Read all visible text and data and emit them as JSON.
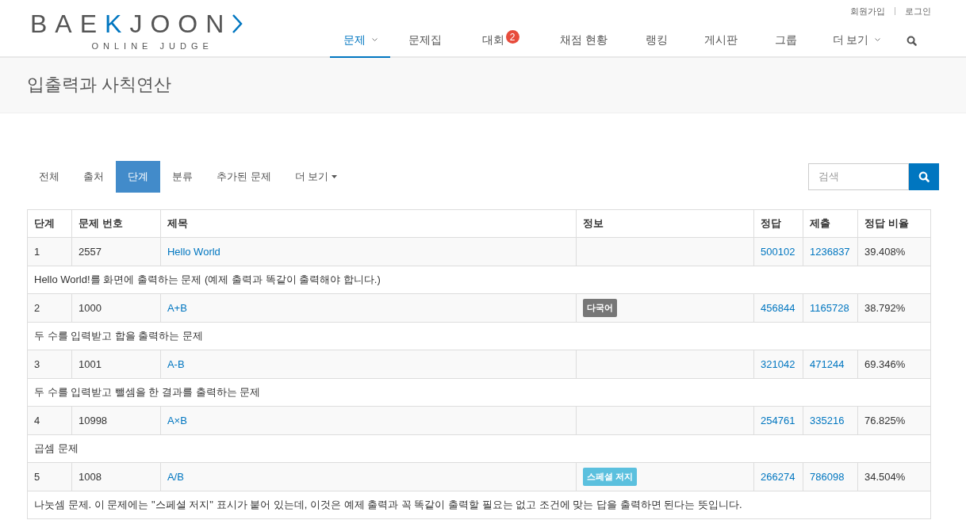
{
  "logo": {
    "parts": [
      {
        "text": "BAE",
        "accent": false
      },
      {
        "text": "K",
        "accent": true
      },
      {
        "text": "JOON",
        "accent": false
      }
    ],
    "subtitle": "ONLINE JUDGE"
  },
  "top_links": [
    "회원가입",
    "로그인"
  ],
  "nav": [
    {
      "label": "문제",
      "selected": true,
      "dropdown": true
    },
    {
      "label": "문제집",
      "selected": false,
      "dropdown": false
    },
    {
      "label": "대회",
      "selected": false,
      "dropdown": false,
      "badge": "2"
    },
    {
      "label": "채점 현황",
      "selected": false,
      "dropdown": false
    },
    {
      "label": "랭킹",
      "selected": false,
      "dropdown": false
    },
    {
      "label": "게시판",
      "selected": false,
      "dropdown": false
    },
    {
      "label": "그룹",
      "selected": false,
      "dropdown": false
    },
    {
      "label": "더 보기",
      "selected": false,
      "dropdown": true
    }
  ],
  "page_title": "입출력과 사칙연산",
  "tabs": [
    {
      "label": "전체",
      "selected": false,
      "dropdown": false
    },
    {
      "label": "출처",
      "selected": false,
      "dropdown": false
    },
    {
      "label": "단계",
      "selected": true,
      "dropdown": false
    },
    {
      "label": "분류",
      "selected": false,
      "dropdown": false
    },
    {
      "label": "추가된 문제",
      "selected": false,
      "dropdown": false
    },
    {
      "label": "더 보기",
      "selected": false,
      "dropdown": true
    }
  ],
  "search": {
    "placeholder": "검색"
  },
  "table": {
    "columns": [
      "단계",
      "문제 번호",
      "제목",
      "정보",
      "정답",
      "제출",
      "정답 비율"
    ],
    "rows": [
      {
        "step": "1",
        "number": "2557",
        "title": "Hello World",
        "solved": "500102",
        "submitted": "1236837",
        "ratio": "39.408%",
        "description": "Hello World!를 화면에 출력하는 문제 (예제 출력과 똑같이 출력해야 합니다.)"
      },
      {
        "step": "2",
        "number": "1000",
        "title": "A+B",
        "tag": {
          "label": "다국어",
          "kind": "multilang"
        },
        "solved": "456844",
        "submitted": "1165728",
        "ratio": "38.792%",
        "description": "두 수를 입력받고 합을 출력하는 문제"
      },
      {
        "step": "3",
        "number": "1001",
        "title": "A-B",
        "solved": "321042",
        "submitted": "471244",
        "ratio": "69.346%",
        "description": "두 수를 입력받고 뺄셈을 한 결과를 출력하는 문제"
      },
      {
        "step": "4",
        "number": "10998",
        "title": "A×B",
        "solved": "254761",
        "submitted": "335216",
        "ratio": "76.825%",
        "description": "곱셈 문제"
      },
      {
        "step": "5",
        "number": "1008",
        "title": "A/B",
        "tag": {
          "label": "스페셜 저지",
          "kind": "special"
        },
        "solved": "266274",
        "submitted": "786098",
        "ratio": "34.504%",
        "description": "나눗셈 문제. 이 문제에는 \"스페셜 저지\" 표시가 붙어 있는데, 이것은 예제 출력과 꼭 똑같이 출력할 필요는 없고 조건에 맞는 답을 출력하면 된다는 뜻입니다."
      }
    ]
  }
}
